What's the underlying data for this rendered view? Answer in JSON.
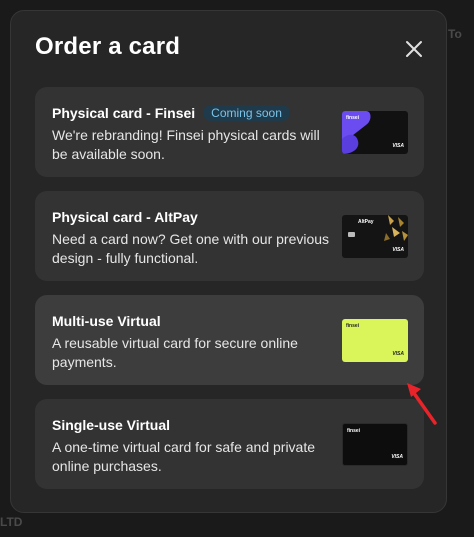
{
  "background": {
    "ghost_texts": [
      "To",
      "LTD",
      "LTD",
      "LTD",
      "LTD"
    ]
  },
  "modal": {
    "title": "Order a card",
    "close_icon": "close-icon"
  },
  "options": [
    {
      "title": "Physical card - Finsei",
      "badge": "Coming soon",
      "description": "We're rebranding! Finsei physical cards will be available soon.",
      "card_style": "finsei-purple",
      "card_logo": "finsei",
      "card_network": "VISA"
    },
    {
      "title": "Physical card - AltPay",
      "description": "Need a card now? Get one with our previous design - fully functional.",
      "card_style": "altpay-gold",
      "card_logo": "AltPay",
      "card_network": "VISA"
    },
    {
      "title": "Multi-use Virtual",
      "description": "A reusable virtual card for secure online payments.",
      "card_style": "lime",
      "card_logo": "finsei",
      "card_network": "VISA"
    },
    {
      "title": "Single-use Virtual",
      "description": "A one-time virtual card for safe and private online purchases.",
      "card_style": "black",
      "card_logo": "finsei",
      "card_network": "VISA"
    }
  ],
  "colors": {
    "accent_badge": "#7cc3e8",
    "lime_card": "#d9f55a",
    "arrow": "#e8242a"
  }
}
